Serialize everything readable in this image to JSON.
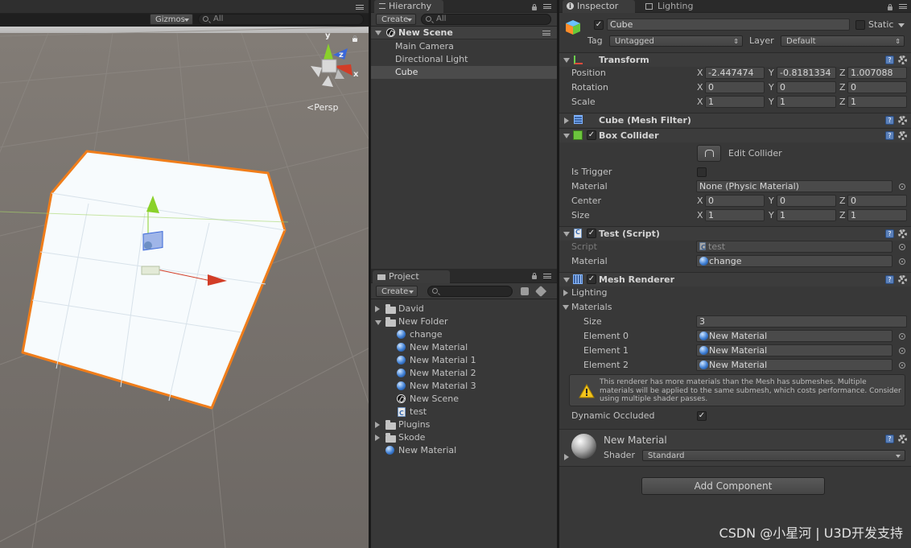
{
  "scene": {
    "gizmos_label": "Gizmos",
    "search_placeholder": "All",
    "persp_label": "Persp",
    "axis": {
      "x": "x",
      "y": "y",
      "z": "z"
    }
  },
  "hierarchy": {
    "tab_label": "Hierarchy",
    "create_label": "Create",
    "search_placeholder": "All",
    "scene_name": "New Scene",
    "items": [
      {
        "label": "Main Camera"
      },
      {
        "label": "Directional Light"
      },
      {
        "label": "Cube"
      }
    ],
    "selected_index": 2
  },
  "project": {
    "tab_label": "Project",
    "create_label": "Create",
    "items": [
      {
        "label": "David",
        "type": "folder",
        "depth": 0,
        "expanded": false
      },
      {
        "label": "New Folder",
        "type": "folder",
        "depth": 0,
        "expanded": true
      },
      {
        "label": "change",
        "type": "material",
        "depth": 1
      },
      {
        "label": "New Material",
        "type": "material",
        "depth": 1
      },
      {
        "label": "New Material 1",
        "type": "material",
        "depth": 1
      },
      {
        "label": "New Material 2",
        "type": "material",
        "depth": 1
      },
      {
        "label": "New Material 3",
        "type": "material",
        "depth": 1
      },
      {
        "label": "New Scene",
        "type": "scene",
        "depth": 1
      },
      {
        "label": "test",
        "type": "script",
        "depth": 1
      },
      {
        "label": "Plugins",
        "type": "folder",
        "depth": 0,
        "expanded": false
      },
      {
        "label": "Skode",
        "type": "folder",
        "depth": 0,
        "expanded": false
      },
      {
        "label": "New Material",
        "type": "material",
        "depth": 0
      }
    ]
  },
  "inspector": {
    "tab_label": "Inspector",
    "lighting_tab_label": "Lighting",
    "object_name": "Cube",
    "static_label": "Static",
    "tag_label": "Tag",
    "tag_value": "Untagged",
    "layer_label": "Layer",
    "layer_value": "Default",
    "transform": {
      "title": "Transform",
      "rows": [
        {
          "label": "Position",
          "x": "-2.447474",
          "y": "-0.8181334",
          "z": "1.007088"
        },
        {
          "label": "Rotation",
          "x": "0",
          "y": "0",
          "z": "0"
        },
        {
          "label": "Scale",
          "x": "1",
          "y": "1",
          "z": "1"
        }
      ]
    },
    "mesh_filter": {
      "title": "Cube (Mesh Filter)"
    },
    "box_collider": {
      "title": "Box Collider",
      "edit_collider": "Edit Collider",
      "is_trigger_label": "Is Trigger",
      "material_label": "Material",
      "material_value": "None (Physic Material)",
      "center_label": "Center",
      "center": {
        "x": "0",
        "y": "0",
        "z": "0"
      },
      "size_label": "Size",
      "size": {
        "x": "1",
        "y": "1",
        "z": "1"
      }
    },
    "test_script": {
      "title": "Test (Script)",
      "script_label": "Script",
      "script_value": "test",
      "material_label": "Material",
      "material_value": "change"
    },
    "mesh_renderer": {
      "title": "Mesh Renderer",
      "lighting_label": "Lighting",
      "materials_label": "Materials",
      "size_label": "Size",
      "size_value": "3",
      "elements": [
        {
          "label": "Element 0",
          "value": "New Material"
        },
        {
          "label": "Element 1",
          "value": "New Material"
        },
        {
          "label": "Element 2",
          "value": "New Material"
        }
      ],
      "warning": "This renderer has more materials than the Mesh has submeshes. Multiple materials will be applied to the same submesh, which costs performance. Consider using multiple shader passes.",
      "dynamic_occluded_label": "Dynamic Occluded"
    },
    "material_preview": {
      "name": "New Material",
      "shader_label": "Shader",
      "shader_value": "Standard"
    },
    "add_component_label": "Add Component"
  },
  "watermark": "CSDN @小星河 | U3D开发支持",
  "colors": {
    "selection_outline": "#f07d1a",
    "x_axis": "#d23d27",
    "y_axis": "#8ad12a",
    "z_axis": "#3a67d9",
    "panel_bg": "#383838",
    "selected_row": "#4b4b4b"
  }
}
